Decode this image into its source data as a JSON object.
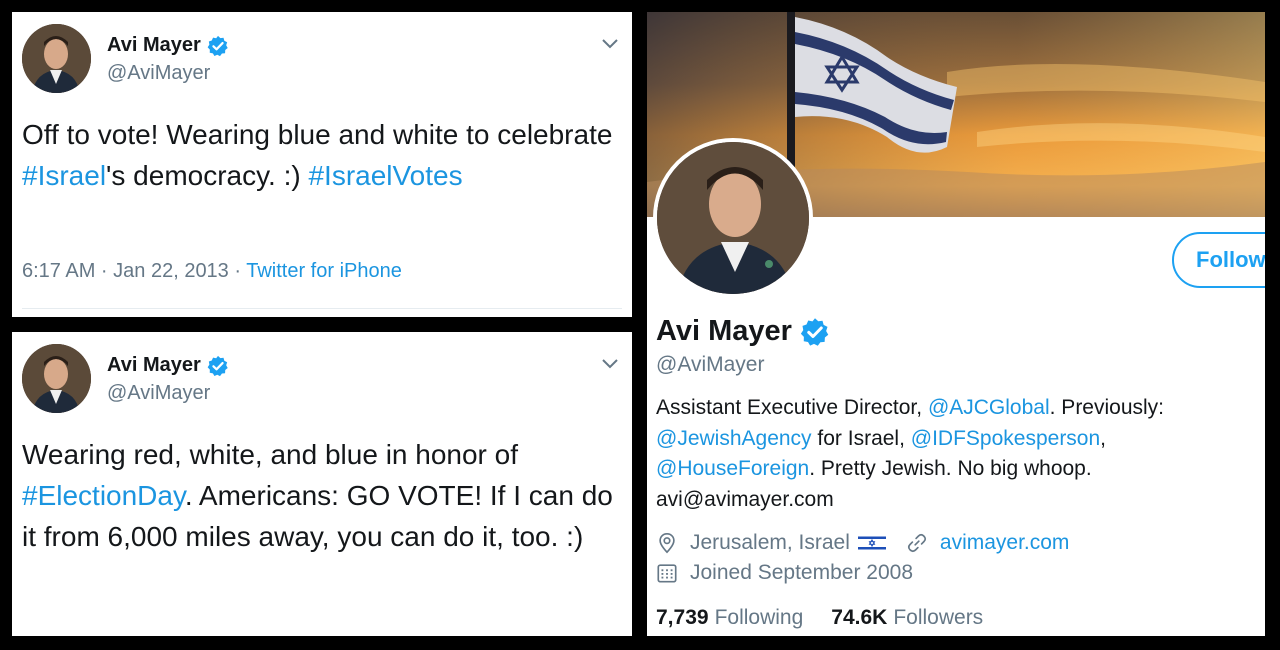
{
  "tweets": [
    {
      "name": "Avi Mayer",
      "handle": "@AviMayer",
      "text_parts": [
        {
          "t": "Off to vote! Wearing blue and white to celebrate ",
          "link": false
        },
        {
          "t": "#Israel",
          "link": true
        },
        {
          "t": "'s democracy. :) ",
          "link": false
        },
        {
          "t": "#IsraelVotes",
          "link": true
        }
      ],
      "time": "6:17 AM · Jan 22, 2013 · ",
      "source": "Twitter for iPhone"
    },
    {
      "name": "Avi Mayer",
      "handle": "@AviMayer",
      "text_parts": [
        {
          "t": "Wearing red, white, and blue in honor of ",
          "link": false
        },
        {
          "t": "#ElectionDay",
          "link": true
        },
        {
          "t": ". Americans: GO VOTE! If I can do it from 6,000 miles away, you can do it, too. :)",
          "link": false
        }
      ],
      "time": "",
      "source": ""
    }
  ],
  "profile": {
    "name": "Avi Mayer",
    "handle": "@AviMayer",
    "follow_label": "Follow",
    "bio_parts": [
      {
        "t": "Assistant Executive Director, ",
        "link": false
      },
      {
        "t": "@AJCGlobal",
        "link": true
      },
      {
        "t": ". Previously: ",
        "link": false
      },
      {
        "t": "@JewishAgency",
        "link": true
      },
      {
        "t": " for Israel, ",
        "link": false
      },
      {
        "t": "@IDFSpokesperson",
        "link": true
      },
      {
        "t": ", ",
        "link": false
      },
      {
        "t": "@HouseForeign",
        "link": true
      },
      {
        "t": ". Pretty Jewish. No big whoop. avi@avimayer.com",
        "link": false
      }
    ],
    "location": "Jerusalem, Israel",
    "website": "avimayer.com",
    "joined": "Joined September 2008",
    "following_count": "7,739",
    "following_label": "Following",
    "followers_count": "74.6K",
    "followers_label": "Followers"
  },
  "icons": [
    "verified-badge-icon",
    "chevron-down-icon",
    "location-pin-icon",
    "link-icon",
    "calendar-icon",
    "israel-flag-icon"
  ],
  "colors": {
    "link": "#1b95e0",
    "muted": "#657786",
    "follow": "#1da1f2",
    "background": "#000000"
  }
}
